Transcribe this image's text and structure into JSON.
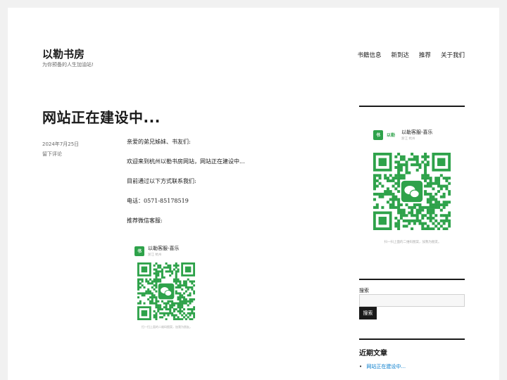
{
  "site": {
    "title": "以勒书房",
    "description": "为你预备的人生加油站!"
  },
  "nav": {
    "items": [
      "书籍信息",
      "新到达",
      "推荐",
      "关于我们"
    ]
  },
  "post": {
    "title": "网站正在建设中...",
    "date": "2024年7月25日",
    "comment_link": "留下评论",
    "paragraphs": [
      "亲爱的弟兄姊妹、书友们:",
      "欢迎来到杭州以勒书房网站，网站正在建设中...",
      "目前通过以下方式联系我们:",
      "电话：0571-85178519",
      "推荐微信客服:"
    ]
  },
  "qr": {
    "logo_box": "书",
    "logo_text": "以勒",
    "name": "以勒客服-喜乐",
    "region": "浙江 杭州",
    "caption": "扫一扫上面的二维码图案，加我为朋友。",
    "accent": "#2ea24a"
  },
  "sidebar": {
    "search_label": "搜索",
    "search_placeholder": "",
    "search_button": "搜索",
    "recent_title": "近期文章",
    "recent_posts": [
      "网站正在建设中..."
    ]
  }
}
